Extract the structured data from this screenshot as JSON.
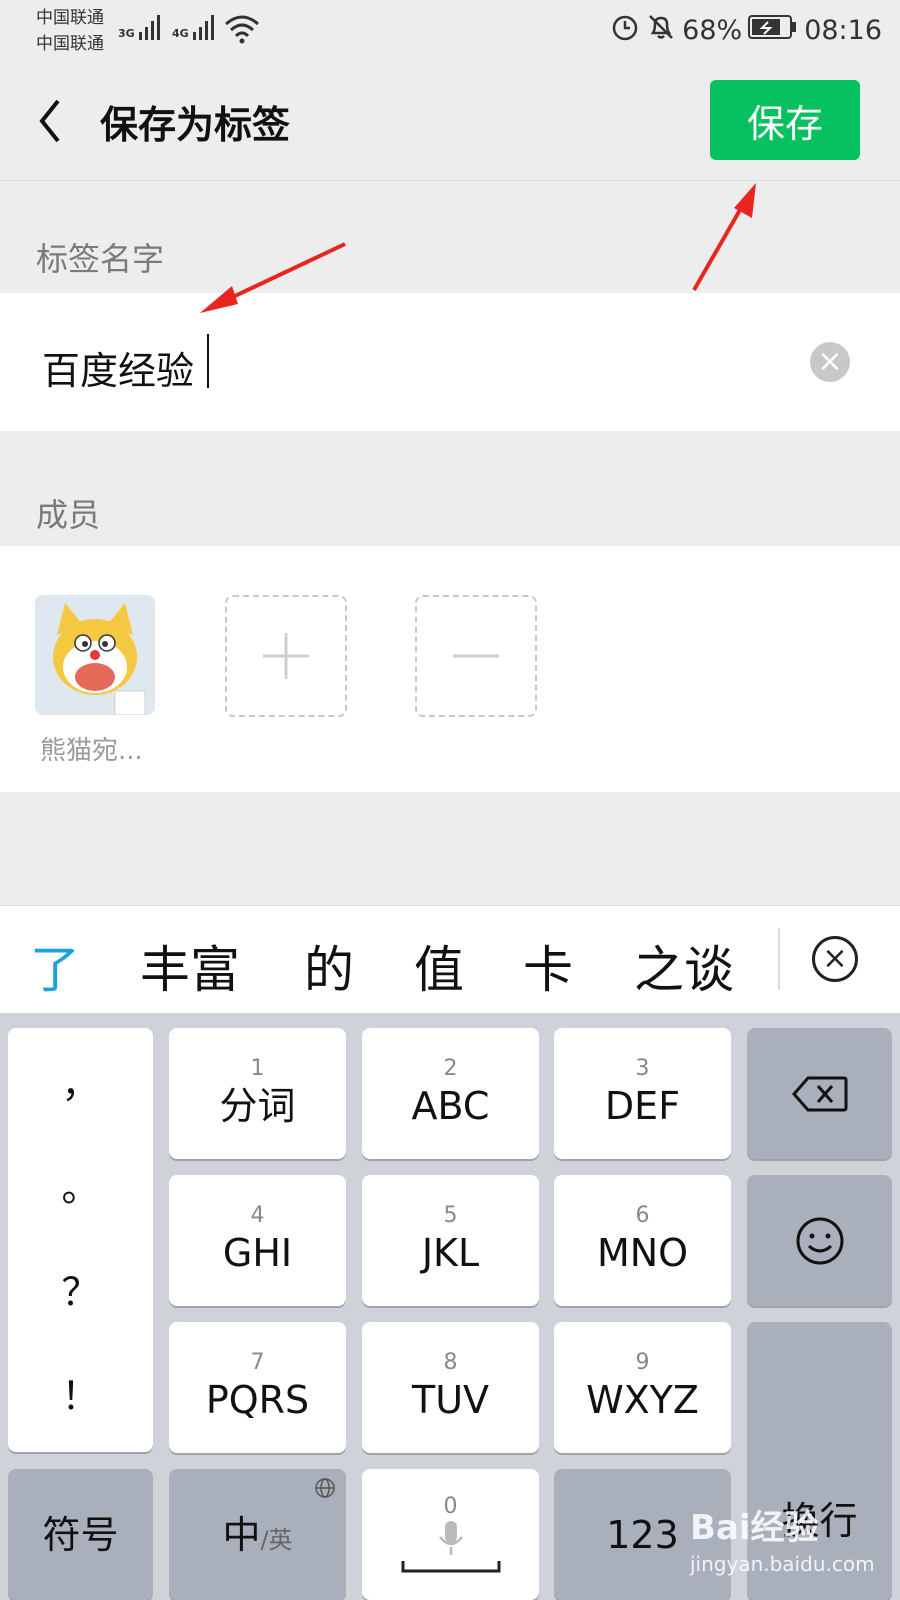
{
  "status_bar": {
    "carrier_1": "中国联通",
    "carrier_2": "中国联通",
    "signal_1": "3G",
    "signal_2": "4G",
    "battery": "68%",
    "time": "08:16"
  },
  "header": {
    "title": "保存为标签",
    "save_label": "保存"
  },
  "tag_name": {
    "section_label": "标签名字",
    "value": "百度经验"
  },
  "members": {
    "section_label": "成员",
    "items": [
      {
        "name": "熊猫宛..."
      }
    ]
  },
  "ime": {
    "candidates": [
      "了",
      "丰富",
      "的",
      "值",
      "卡",
      "之谈"
    ],
    "highlight_color": "#1aa3d9"
  },
  "keyboard": {
    "punctuation": [
      "，",
      "。",
      "？",
      "！"
    ],
    "keys": [
      {
        "num": "1",
        "label": "分词"
      },
      {
        "num": "2",
        "label": "ABC"
      },
      {
        "num": "3",
        "label": "DEF"
      },
      {
        "num": "4",
        "label": "GHI"
      },
      {
        "num": "5",
        "label": "JKL"
      },
      {
        "num": "6",
        "label": "MNO"
      },
      {
        "num": "7",
        "label": "PQRS"
      },
      {
        "num": "8",
        "label": "TUV"
      },
      {
        "num": "9",
        "label": "WXYZ"
      }
    ],
    "symbol_label": "符号",
    "lang_main": "中",
    "lang_sub": "/英",
    "space_num": "0",
    "num_label": "123",
    "enter_label": "换行"
  },
  "watermark": {
    "text": "Bai经验",
    "url": "jingyan.baidu.com"
  },
  "colors": {
    "accent": "#07c160",
    "annotation_arrow": "#e8261f"
  }
}
